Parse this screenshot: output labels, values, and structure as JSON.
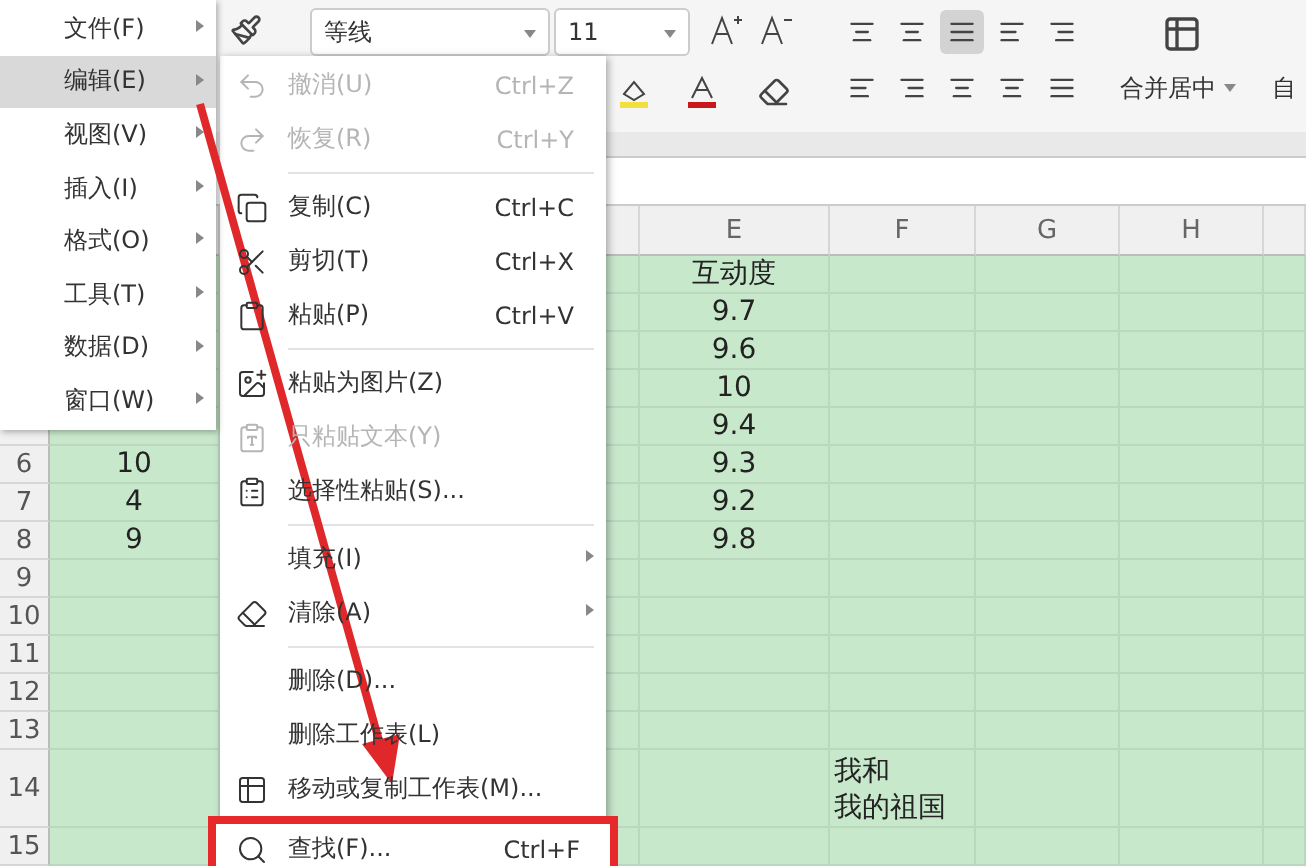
{
  "toolbar": {
    "font_name": "等线",
    "font_size": "11",
    "align_buttons": [
      {
        "selected": false
      },
      {
        "selected": false
      },
      {
        "selected": true
      },
      {
        "selected": false
      },
      {
        "selected": false
      }
    ],
    "merge_label": "合并居中",
    "auto_label": "自"
  },
  "sheet": {
    "columns": [
      "E",
      "F",
      "G",
      "H"
    ],
    "rows": [
      {
        "e": "互动度"
      },
      {
        "e": "9.7"
      },
      {
        "e": "9.6"
      },
      {
        "e": "10"
      },
      {
        "e": "9.4"
      },
      {
        "number": "6",
        "a": "10",
        "e": "9.3"
      },
      {
        "number": "7",
        "a": "4",
        "e": "9.2"
      },
      {
        "number": "8",
        "a": "9",
        "e": "9.8"
      },
      {
        "number": "9"
      },
      {
        "number": "10"
      },
      {
        "number": "11"
      },
      {
        "number": "12"
      },
      {
        "number": "13"
      },
      {
        "number": "14",
        "tall": true,
        "f": [
          "我和",
          "我的祖国"
        ]
      },
      {
        "number": "15"
      }
    ]
  },
  "main_menu": [
    {
      "label": "文件(F)",
      "selected": false
    },
    {
      "label": "编辑(E)",
      "selected": true
    },
    {
      "label": "视图(V)",
      "selected": false
    },
    {
      "label": "插入(I)",
      "selected": false
    },
    {
      "label": "格式(O)",
      "selected": false
    },
    {
      "label": "工具(T)",
      "selected": false
    },
    {
      "label": "数据(D)",
      "selected": false
    },
    {
      "label": "窗口(W)",
      "selected": false
    }
  ],
  "edit_menu": [
    {
      "kind": "item",
      "label": "撤消(U)",
      "shortcut": "Ctrl+Z",
      "disabled": true
    },
    {
      "kind": "item",
      "label": "恢复(R)",
      "shortcut": "Ctrl+Y",
      "disabled": true
    },
    {
      "kind": "separator"
    },
    {
      "kind": "item",
      "label": "复制(C)",
      "shortcut": "Ctrl+C",
      "disabled": false
    },
    {
      "kind": "item",
      "label": "剪切(T)",
      "shortcut": "Ctrl+X",
      "disabled": false
    },
    {
      "kind": "item",
      "label": "粘贴(P)",
      "shortcut": "Ctrl+V",
      "disabled": false
    },
    {
      "kind": "separator"
    },
    {
      "kind": "item",
      "label": "粘贴为图片(Z)",
      "disabled": false
    },
    {
      "kind": "item",
      "label": "只粘贴文本(Y)",
      "disabled": true
    },
    {
      "kind": "item",
      "label": "选择性粘贴(S)...",
      "disabled": false
    },
    {
      "kind": "separator"
    },
    {
      "kind": "submenu",
      "label": "填充(I)",
      "disabled": false
    },
    {
      "kind": "submenu",
      "label": "清除(A)",
      "disabled": false
    },
    {
      "kind": "separator"
    },
    {
      "kind": "item",
      "label": "删除(D)...",
      "disabled": false
    },
    {
      "kind": "item",
      "label": "删除工作表(L)",
      "disabled": false
    },
    {
      "kind": "item",
      "label": "移动或复制工作表(M)...",
      "disabled": false
    },
    {
      "kind": "item",
      "label": "查找(F)...",
      "shortcut": "Ctrl+F",
      "disabled": false,
      "highlighted": true
    }
  ]
}
